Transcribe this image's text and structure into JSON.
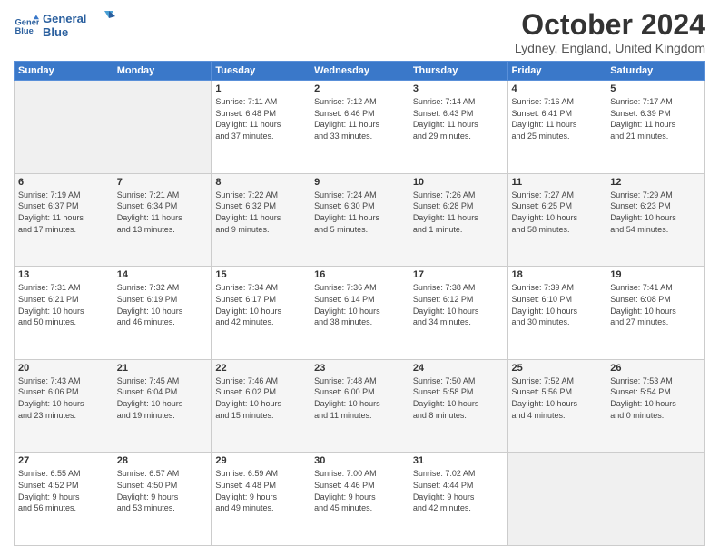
{
  "logo": {
    "line1": "General",
    "line2": "Blue"
  },
  "header": {
    "month": "October 2024",
    "location": "Lydney, England, United Kingdom"
  },
  "days_of_week": [
    "Sunday",
    "Monday",
    "Tuesday",
    "Wednesday",
    "Thursday",
    "Friday",
    "Saturday"
  ],
  "weeks": [
    [
      {
        "day": "",
        "info": ""
      },
      {
        "day": "",
        "info": ""
      },
      {
        "day": "1",
        "info": "Sunrise: 7:11 AM\nSunset: 6:48 PM\nDaylight: 11 hours\nand 37 minutes."
      },
      {
        "day": "2",
        "info": "Sunrise: 7:12 AM\nSunset: 6:46 PM\nDaylight: 11 hours\nand 33 minutes."
      },
      {
        "day": "3",
        "info": "Sunrise: 7:14 AM\nSunset: 6:43 PM\nDaylight: 11 hours\nand 29 minutes."
      },
      {
        "day": "4",
        "info": "Sunrise: 7:16 AM\nSunset: 6:41 PM\nDaylight: 11 hours\nand 25 minutes."
      },
      {
        "day": "5",
        "info": "Sunrise: 7:17 AM\nSunset: 6:39 PM\nDaylight: 11 hours\nand 21 minutes."
      }
    ],
    [
      {
        "day": "6",
        "info": "Sunrise: 7:19 AM\nSunset: 6:37 PM\nDaylight: 11 hours\nand 17 minutes."
      },
      {
        "day": "7",
        "info": "Sunrise: 7:21 AM\nSunset: 6:34 PM\nDaylight: 11 hours\nand 13 minutes."
      },
      {
        "day": "8",
        "info": "Sunrise: 7:22 AM\nSunset: 6:32 PM\nDaylight: 11 hours\nand 9 minutes."
      },
      {
        "day": "9",
        "info": "Sunrise: 7:24 AM\nSunset: 6:30 PM\nDaylight: 11 hours\nand 5 minutes."
      },
      {
        "day": "10",
        "info": "Sunrise: 7:26 AM\nSunset: 6:28 PM\nDaylight: 11 hours\nand 1 minute."
      },
      {
        "day": "11",
        "info": "Sunrise: 7:27 AM\nSunset: 6:25 PM\nDaylight: 10 hours\nand 58 minutes."
      },
      {
        "day": "12",
        "info": "Sunrise: 7:29 AM\nSunset: 6:23 PM\nDaylight: 10 hours\nand 54 minutes."
      }
    ],
    [
      {
        "day": "13",
        "info": "Sunrise: 7:31 AM\nSunset: 6:21 PM\nDaylight: 10 hours\nand 50 minutes."
      },
      {
        "day": "14",
        "info": "Sunrise: 7:32 AM\nSunset: 6:19 PM\nDaylight: 10 hours\nand 46 minutes."
      },
      {
        "day": "15",
        "info": "Sunrise: 7:34 AM\nSunset: 6:17 PM\nDaylight: 10 hours\nand 42 minutes."
      },
      {
        "day": "16",
        "info": "Sunrise: 7:36 AM\nSunset: 6:14 PM\nDaylight: 10 hours\nand 38 minutes."
      },
      {
        "day": "17",
        "info": "Sunrise: 7:38 AM\nSunset: 6:12 PM\nDaylight: 10 hours\nand 34 minutes."
      },
      {
        "day": "18",
        "info": "Sunrise: 7:39 AM\nSunset: 6:10 PM\nDaylight: 10 hours\nand 30 minutes."
      },
      {
        "day": "19",
        "info": "Sunrise: 7:41 AM\nSunset: 6:08 PM\nDaylight: 10 hours\nand 27 minutes."
      }
    ],
    [
      {
        "day": "20",
        "info": "Sunrise: 7:43 AM\nSunset: 6:06 PM\nDaylight: 10 hours\nand 23 minutes."
      },
      {
        "day": "21",
        "info": "Sunrise: 7:45 AM\nSunset: 6:04 PM\nDaylight: 10 hours\nand 19 minutes."
      },
      {
        "day": "22",
        "info": "Sunrise: 7:46 AM\nSunset: 6:02 PM\nDaylight: 10 hours\nand 15 minutes."
      },
      {
        "day": "23",
        "info": "Sunrise: 7:48 AM\nSunset: 6:00 PM\nDaylight: 10 hours\nand 11 minutes."
      },
      {
        "day": "24",
        "info": "Sunrise: 7:50 AM\nSunset: 5:58 PM\nDaylight: 10 hours\nand 8 minutes."
      },
      {
        "day": "25",
        "info": "Sunrise: 7:52 AM\nSunset: 5:56 PM\nDaylight: 10 hours\nand 4 minutes."
      },
      {
        "day": "26",
        "info": "Sunrise: 7:53 AM\nSunset: 5:54 PM\nDaylight: 10 hours\nand 0 minutes."
      }
    ],
    [
      {
        "day": "27",
        "info": "Sunrise: 6:55 AM\nSunset: 4:52 PM\nDaylight: 9 hours\nand 56 minutes."
      },
      {
        "day": "28",
        "info": "Sunrise: 6:57 AM\nSunset: 4:50 PM\nDaylight: 9 hours\nand 53 minutes."
      },
      {
        "day": "29",
        "info": "Sunrise: 6:59 AM\nSunset: 4:48 PM\nDaylight: 9 hours\nand 49 minutes."
      },
      {
        "day": "30",
        "info": "Sunrise: 7:00 AM\nSunset: 4:46 PM\nDaylight: 9 hours\nand 45 minutes."
      },
      {
        "day": "31",
        "info": "Sunrise: 7:02 AM\nSunset: 4:44 PM\nDaylight: 9 hours\nand 42 minutes."
      },
      {
        "day": "",
        "info": ""
      },
      {
        "day": "",
        "info": ""
      }
    ]
  ]
}
